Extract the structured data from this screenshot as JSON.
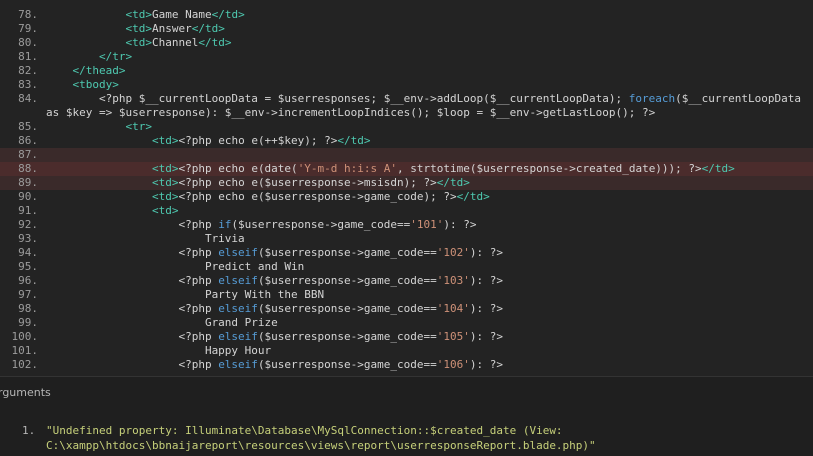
{
  "code_lines": [
    {
      "ln": "78.",
      "html": "            <span class=\"tag\">&lt;td&gt;</span>Game Name<span class=\"tag\">&lt;/td&gt;</span>"
    },
    {
      "ln": "79.",
      "html": "            <span class=\"tag\">&lt;td&gt;</span>Answer<span class=\"tag\">&lt;/td&gt;</span>"
    },
    {
      "ln": "80.",
      "html": "            <span class=\"tag\">&lt;td&gt;</span>Channel<span class=\"tag\">&lt;/td&gt;</span>"
    },
    {
      "ln": "81.",
      "html": "        <span class=\"tag\">&lt;/tr&gt;</span>"
    },
    {
      "ln": "82.",
      "html": "    <span class=\"tag\">&lt;/thead&gt;</span>"
    },
    {
      "ln": "83.",
      "html": "    <span class=\"tag\">&lt;tbody&gt;</span>"
    },
    {
      "ln": "84.",
      "html": "        &lt;?php $__currentLoopData = $userresponses; $__env-&gt;addLoop($__currentLoopData); <span class=\"kw\">foreach</span>($__currentLoopData"
    },
    {
      "ln": "",
      "html": "as $key =&gt; $userresponse): $__env-&gt;incrementLoopIndices(); $loop = $__env-&gt;getLastLoop(); ?&gt;",
      "cont": true
    },
    {
      "ln": "85.",
      "html": "            <span class=\"tag\">&lt;tr&gt;</span>"
    },
    {
      "ln": "86.",
      "html": "                <span class=\"tag\">&lt;td&gt;</span>&lt;?php echo e(++$key); ?&gt;<span class=\"tag\">&lt;/td&gt;</span>"
    },
    {
      "ln": "87.",
      "html": "",
      "hl": "hl"
    },
    {
      "ln": "88.",
      "html": "                <span class=\"tag\">&lt;td&gt;</span>&lt;?php echo e(date(<span class=\"str\">'Y-m-d h:i:s A'</span>, strtotime($userresponse-&gt;created_date))); ?&gt;<span class=\"tag\">&lt;/td&gt;</span>",
      "hl": "hl-strong"
    },
    {
      "ln": "89.",
      "html": "                <span class=\"tag\">&lt;td&gt;</span>&lt;?php echo e($userresponse-&gt;msisdn); ?&gt;<span class=\"tag\">&lt;/td&gt;</span>",
      "hl": "hl"
    },
    {
      "ln": "90.",
      "html": "                <span class=\"tag\">&lt;td&gt;</span>&lt;?php echo e($userresponse-&gt;game_code); ?&gt;<span class=\"tag\">&lt;/td&gt;</span>"
    },
    {
      "ln": "91.",
      "html": "                <span class=\"tag\">&lt;td&gt;</span>"
    },
    {
      "ln": "92.",
      "html": "                    &lt;?php <span class=\"kw\">if</span>($userresponse-&gt;game_code==<span class=\"str\">'101'</span>): ?&gt;"
    },
    {
      "ln": "93.",
      "html": "                        Trivia"
    },
    {
      "ln": "94.",
      "html": "                    &lt;?php <span class=\"kw\">elseif</span>($userresponse-&gt;game_code==<span class=\"str\">'102'</span>): ?&gt;"
    },
    {
      "ln": "95.",
      "html": "                        Predict and Win"
    },
    {
      "ln": "96.",
      "html": "                    &lt;?php <span class=\"kw\">elseif</span>($userresponse-&gt;game_code==<span class=\"str\">'103'</span>): ?&gt;"
    },
    {
      "ln": "97.",
      "html": "                        Party With the BBN"
    },
    {
      "ln": "98.",
      "html": "                    &lt;?php <span class=\"kw\">elseif</span>($userresponse-&gt;game_code==<span class=\"str\">'104'</span>): ?&gt;"
    },
    {
      "ln": "99.",
      "html": "                        Grand Prize"
    },
    {
      "ln": "100.",
      "html": "                    &lt;?php <span class=\"kw\">elseif</span>($userresponse-&gt;game_code==<span class=\"str\">'105'</span>): ?&gt;"
    },
    {
      "ln": "101.",
      "html": "                        Happy Hour"
    },
    {
      "ln": "102.",
      "html": "                    &lt;?php <span class=\"kw\">elseif</span>($userresponse-&gt;game_code==<span class=\"str\">'106'</span>): ?&gt;"
    }
  ],
  "args": {
    "title": "rguments",
    "items": [
      {
        "num": "1.",
        "text": "\"Undefined property: Illuminate\\Database\\MySqlConnection::$created_date (View:\nC:\\xampp\\htdocs\\bbnaijareport\\resources\\views\\report\\userresponseReport.blade.php)\""
      }
    ]
  },
  "colors": {
    "tag": "#4ec9b0",
    "keyword": "#569cd6",
    "string": "#ce9178",
    "highlight": "#4b2c2c",
    "argument": "#c6d07a"
  }
}
